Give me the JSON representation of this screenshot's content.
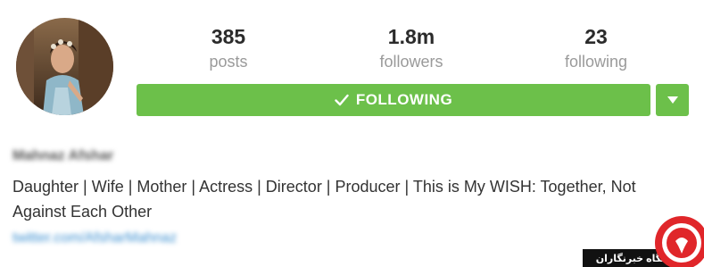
{
  "profile": {
    "name": "Mahnaz Afshar",
    "bio": "Daughter | Wife | Mother | Actress | Director | Producer | This is My WISH: Together, Not Against Each Other",
    "link": "twitter.com/AfsharMahnaz"
  },
  "stats": {
    "posts": {
      "value": "385",
      "label": "posts"
    },
    "followers": {
      "value": "1.8m",
      "label": "followers"
    },
    "following": {
      "value": "23",
      "label": "following"
    }
  },
  "actions": {
    "following_label": "FOLLOWING",
    "dropdown_icon": "caret-down-icon"
  },
  "watermark": {
    "text": "باشگاه خبرنگاران"
  },
  "colors": {
    "accent": "#6cc04a",
    "link": "#3b8fd0",
    "stat_value": "#2b2b2b",
    "stat_label": "#9a9a9a",
    "watermark_red": "#e0262a"
  }
}
